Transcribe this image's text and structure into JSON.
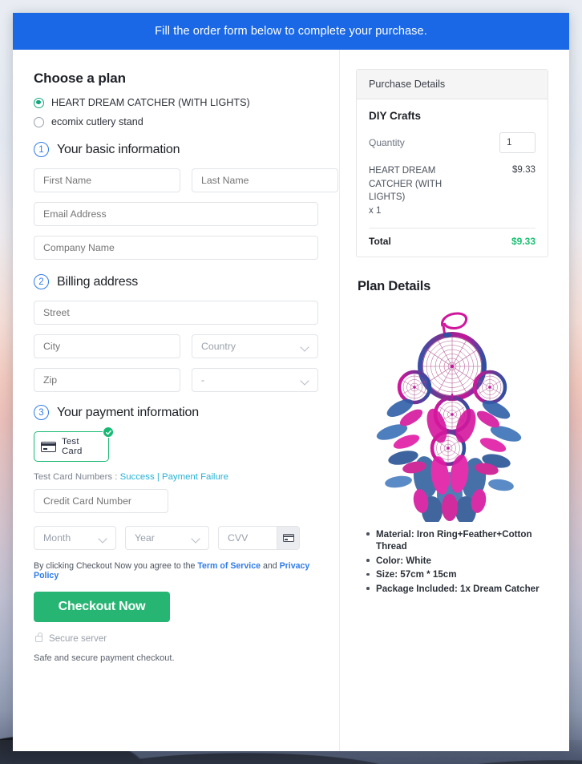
{
  "banner": {
    "text": "Fill the order form below to complete your purchase."
  },
  "plans": {
    "heading": "Choose a plan",
    "options": [
      {
        "label": "HEART DREAM CATCHER (WITH LIGHTS)",
        "selected": true
      },
      {
        "label": "ecomix cutlery stand",
        "selected": false
      }
    ]
  },
  "steps": [
    {
      "number": "1",
      "title": "Your basic information"
    },
    {
      "number": "2",
      "title": "Billing address"
    },
    {
      "number": "3",
      "title": "Your payment information"
    }
  ],
  "basic_info": {
    "first_name_placeholder": "First Name",
    "last_name_placeholder": "Last Name",
    "email_placeholder": "Email Address",
    "company_placeholder": "Company Name"
  },
  "billing": {
    "street_placeholder": "Street",
    "city_placeholder": "City",
    "country_placeholder": "Country",
    "zip_placeholder": "Zip",
    "state_placeholder": "-"
  },
  "payment": {
    "method_label": "Test  Card",
    "method_selected": true,
    "test_card_prefix": "Test Card Numbers : ",
    "test_card_success": "Success",
    "test_card_separator": " | ",
    "test_card_failure": "Payment Failure",
    "cc_number_placeholder": "Credit Card Number",
    "month_placeholder": "Month",
    "year_placeholder": "Year",
    "cvv_placeholder": "CVV"
  },
  "terms": {
    "prefix": "By clicking Checkout Now you agree to the ",
    "tos": "Term of Service",
    "conjunction": " and ",
    "privacy": "Privacy Policy"
  },
  "checkout": {
    "button_label": "Checkout Now",
    "secure_text": "Secure server",
    "footnote": "Safe and secure payment checkout."
  },
  "purchase_details": {
    "header": "Purchase Details",
    "plan_name": "DIY Crafts",
    "quantity_label": "Quantity",
    "quantity_value": "1",
    "line_item_name": "HEART DREAM CATCHER (WITH LIGHTS)",
    "line_item_qty": "x 1",
    "line_item_price": "$9.33",
    "total_label": "Total",
    "total_value": "$9.33"
  },
  "plan_details": {
    "heading": "Plan Details",
    "image_name": "dream-catcher-product-photo",
    "bullets": [
      "Material: Iron Ring+Feather+Cotton Thread",
      "Color: White",
      "Size: 57cm * 15cm",
      "Package Included: 1x Dream Catcher"
    ]
  },
  "colors": {
    "banner_blue": "#1a68e5",
    "step_blue": "#2f7bea",
    "success_green": "#18b974",
    "checkout_green": "#27b573",
    "total_green": "#1dbf73",
    "radio_teal": "#15a67d",
    "link_cyan": "#25b2d4"
  }
}
